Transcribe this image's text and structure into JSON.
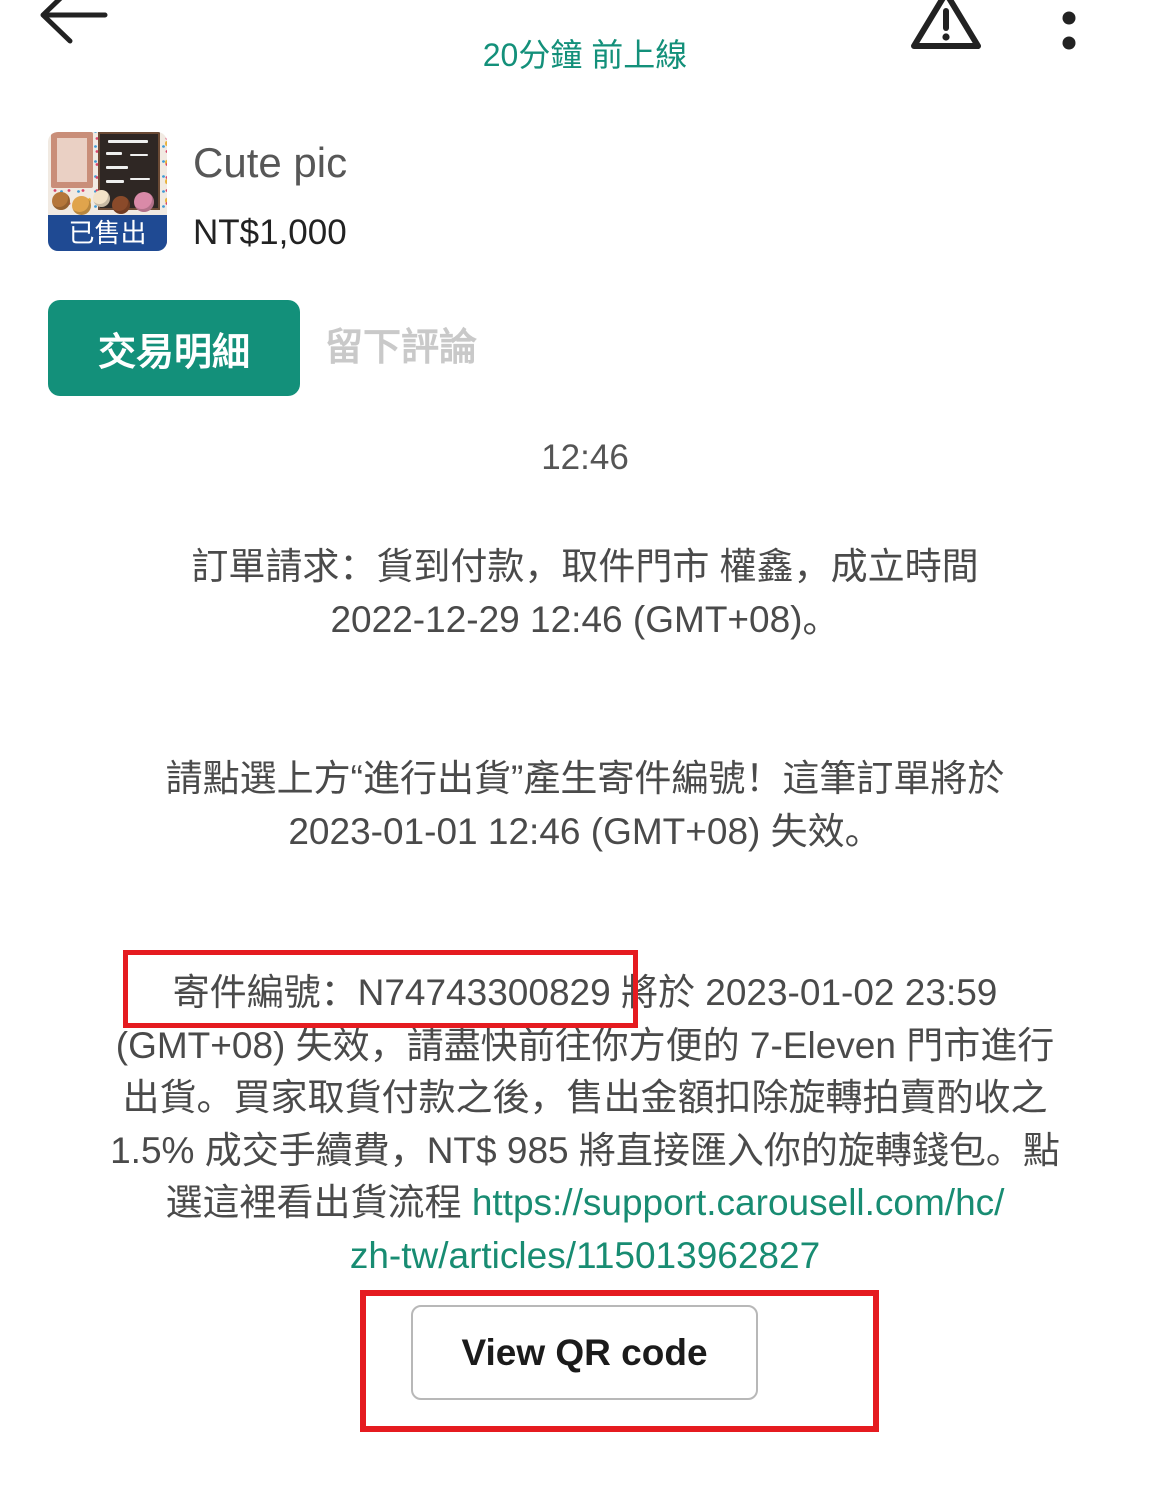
{
  "header": {
    "status": "20分鐘 前上線",
    "back_icon": "arrow-left-icon",
    "report_icon": "warning-icon",
    "menu_icon": "more-vertical-icon"
  },
  "listing": {
    "title": "Cute pic",
    "price": "NT$1,000",
    "sold_badge": "已售出"
  },
  "tabs": {
    "details": "交易明細",
    "review": "留下評論"
  },
  "chat": {
    "timestamp": "12:46",
    "messages": [
      {
        "lines": [
          "訂單請求：貨到付款，取件門市 權鑫，成立時間",
          "2022-12-29 12:46 (GMT+08)。"
        ]
      },
      {
        "lines": [
          "請點選上方“進行出貨”產生寄件編號！這筆訂單將於",
          "2023-01-01 12:46 (GMT+08) 失效。"
        ]
      },
      {
        "lines": [
          "寄件編號：N74743300829 將於 2023-01-02 23:59",
          "(GMT+08) 失效，請盡快前往你方便的 7-Eleven 門市進行",
          "出貨。買家取貨付款之後，售出金額扣除旋轉拍賣酌收之",
          "1.5% 成交手續費，NT$ 985 將直接匯入你的旋轉錢包。點",
          "選這裡看出貨流程"
        ],
        "link_lines": [
          "https://support.carousell.com/hc/",
          "zh-tw/articles/115013962827"
        ]
      }
    ],
    "qr_button": "View QR code"
  },
  "colors": {
    "accent": "#13907a",
    "link": "#188c72",
    "sold_badge": "#1f4a93",
    "annotation": "#e51b20",
    "disabled": "#c9c9c9"
  }
}
